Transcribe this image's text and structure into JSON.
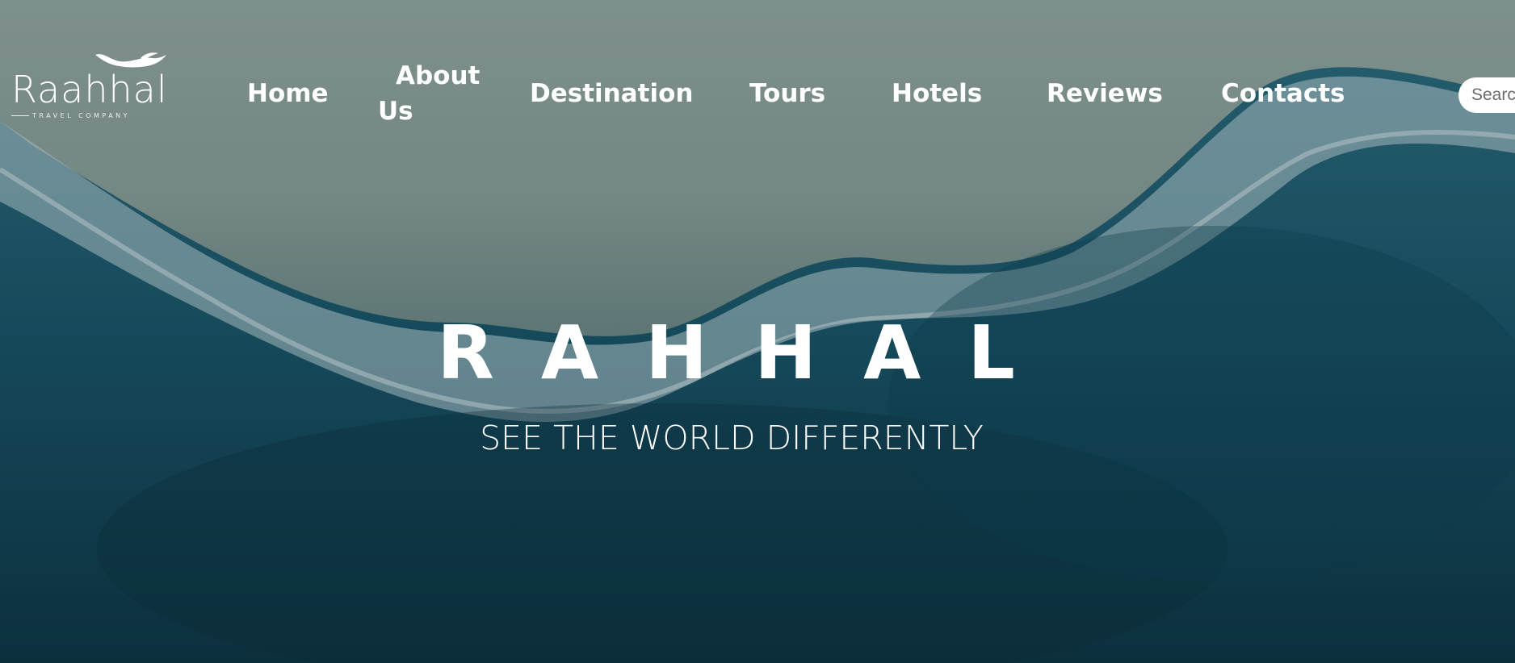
{
  "brand": {
    "name": "Raahhal",
    "tagline": "TRAVEL COMPANY",
    "icon": "bird-icon"
  },
  "nav": {
    "items": [
      {
        "label": "Home"
      },
      {
        "label": "About Us"
      },
      {
        "label": "Destination"
      },
      {
        "label": "Tours"
      },
      {
        "label": "Hotels"
      },
      {
        "label": "Reviews"
      },
      {
        "label": "Contacts"
      }
    ]
  },
  "search": {
    "placeholder": "Search"
  },
  "hero": {
    "title": "RAHHAL",
    "subtitle": "SEE THE WORLD DIFFERENTLY"
  },
  "colors": {
    "text": "#ffffff",
    "sea_dark": "#0e3645",
    "sea_mid": "#1d5a6c",
    "sand": "#7f938d"
  }
}
